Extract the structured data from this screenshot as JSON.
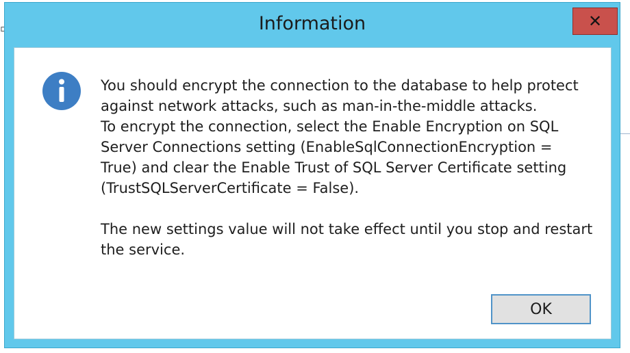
{
  "dialog": {
    "title": "Information",
    "close_icon": "close-icon",
    "info_icon": "information-icon",
    "message_lines": [
      "You should encrypt the connection to the database to help protect",
      "against network attacks, such as man-in-the-middle attacks.",
      "To encrypt the connection, select the Enable Encryption on SQL",
      "Server Connections setting (EnableSqlConnectionEncryption =",
      "True) and clear the Enable Trust of SQL Server Certificate setting",
      "(TrustSQLServerCertificate = False)."
    ],
    "note_lines": [
      "The new settings value will not take effect until you stop and restart",
      "the service."
    ],
    "ok_label": "OK"
  },
  "colors": {
    "frame": "#61c8eb",
    "close_button": "#c9514c",
    "info_icon": "#3d7ec4",
    "ok_border": "#4f93c8"
  }
}
